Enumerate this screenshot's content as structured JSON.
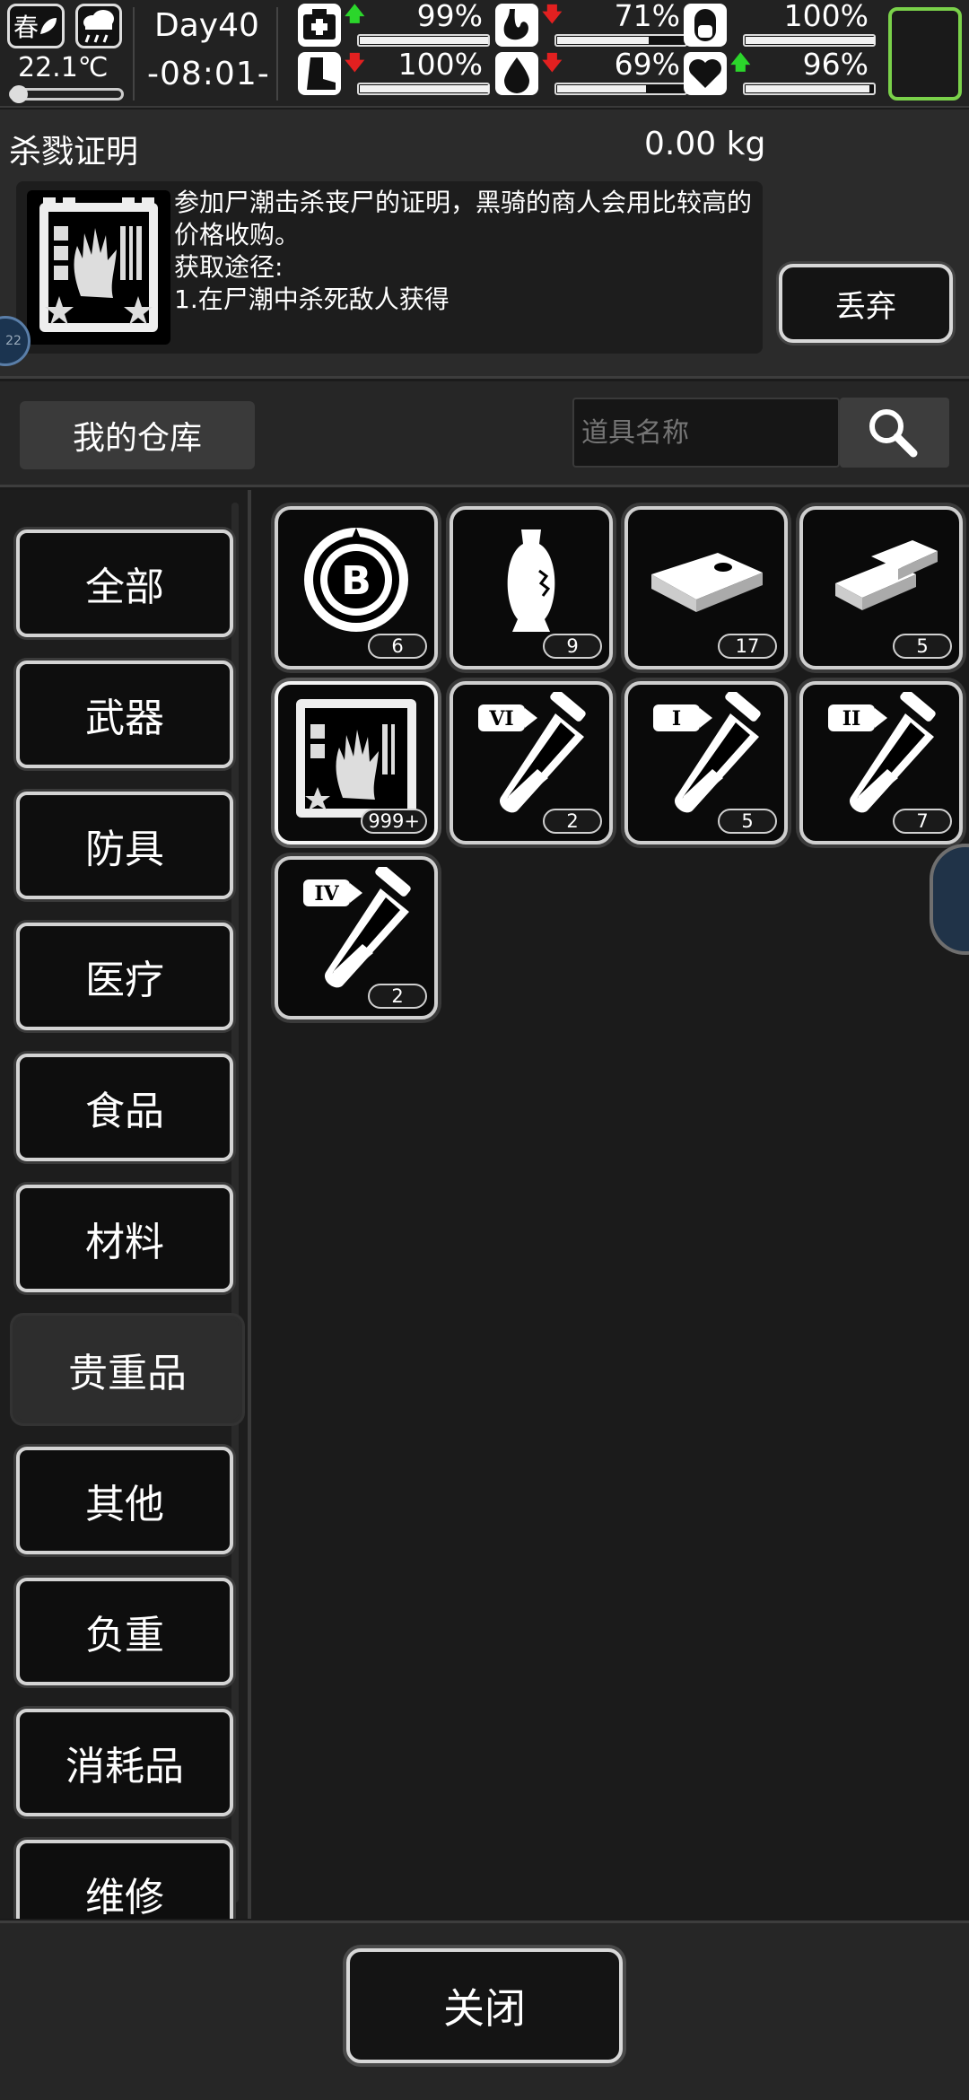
{
  "status": {
    "season": "春",
    "temperature": "22.1℃",
    "day": "Day40",
    "time": "-08:01-",
    "stats": [
      {
        "name": "health-stat",
        "icon": "medkit-icon",
        "trend": "up",
        "value": "99%",
        "level": 0.99
      },
      {
        "name": "hunger-stat",
        "icon": "stomach-icon",
        "trend": "down",
        "value": "71%",
        "level": 0.71
      },
      {
        "name": "pill-stat",
        "icon": "pill-icon",
        "trend": "none",
        "value": "100%",
        "level": 1.0
      },
      {
        "name": "stamina-stat",
        "icon": "foot-icon",
        "trend": "down",
        "value": "100%",
        "level": 1.0
      },
      {
        "name": "thirst-stat",
        "icon": "water-drop-icon",
        "trend": "down",
        "value": "69%",
        "level": 0.69
      },
      {
        "name": "mood-stat",
        "icon": "heart-icon",
        "trend": "up",
        "value": "96%",
        "level": 0.96
      }
    ]
  },
  "item": {
    "title": "杀戮证明",
    "weight": "0.00 kg",
    "description": "参加尸潮击杀丧尸的证明，黑骑的商人会用比较高的价格收购。",
    "obtain_label": "获取途径:",
    "obtain_method": "1.在尸潮中杀死敌人获得",
    "discard_label": "丢弃"
  },
  "warehouse": {
    "title": "我的仓库",
    "search_placeholder": "道具名称"
  },
  "categories": [
    "全部",
    "武器",
    "防具",
    "医疗",
    "食品",
    "材料",
    "贵重品",
    "其他",
    "负重",
    "消耗品",
    "维修"
  ],
  "active_category": "贵重品",
  "items": [
    {
      "name": "bitcoin-chip",
      "icon": "bitcoin-icon",
      "qty": "6"
    },
    {
      "name": "porcelain-vase",
      "icon": "vase-icon",
      "qty": "9"
    },
    {
      "name": "cash-bundle",
      "icon": "cash-icon",
      "qty": "17"
    },
    {
      "name": "gold-bars",
      "icon": "gold-bar-icon",
      "qty": "5"
    },
    {
      "name": "kill-proof",
      "icon": "zombie-hand-card-icon",
      "qty": "999+",
      "selected": true
    },
    {
      "name": "test-tube-vi",
      "icon": "test-tube-icon",
      "label": "VI",
      "qty": "2"
    },
    {
      "name": "test-tube-i",
      "icon": "test-tube-icon",
      "label": "I",
      "qty": "5"
    },
    {
      "name": "test-tube-ii",
      "icon": "test-tube-icon",
      "label": "II",
      "qty": "7"
    },
    {
      "name": "test-tube-iv",
      "icon": "test-tube-icon",
      "label": "IV",
      "qty": "2"
    }
  ],
  "footer": {
    "close_label": "关闭"
  }
}
